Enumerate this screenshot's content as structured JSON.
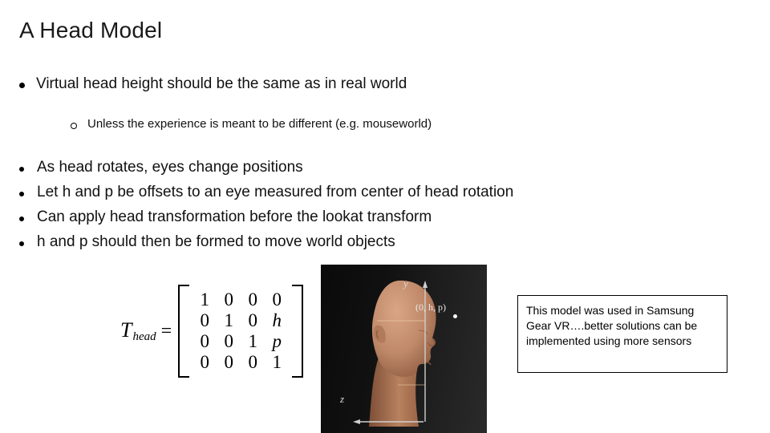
{
  "slide": {
    "title": "A Head Model"
  },
  "bullets": [
    {
      "level": 1,
      "text": "Virtual head height should be the same as in real world"
    },
    {
      "level": 2,
      "text": "Unless the experience is meant to be different (e.g. mouseworld)"
    },
    {
      "level": 1,
      "text": "As head rotates, eyes change positions"
    },
    {
      "level": 1,
      "text": "Let h and p be offsets to an eye measured from center  of head rotation"
    },
    {
      "level": 1,
      "text": "Can apply head transformation before the lookat transform"
    },
    {
      "level": 1,
      "text": "h and p should then be formed to move world objects"
    }
  ],
  "equation": {
    "label": "T",
    "label_subscript": "head",
    "equals": "=",
    "matrix_rows": [
      [
        "1",
        "0",
        "0",
        "0"
      ],
      [
        "0",
        "1",
        "0",
        "h"
      ],
      [
        "0",
        "0",
        "1",
        "p"
      ],
      [
        "0",
        "0",
        "0",
        "1"
      ]
    ],
    "italic_cells": [
      "h",
      "p"
    ]
  },
  "figure": {
    "axis_y_label": "y",
    "axis_z_label": "z",
    "point_label": "(0, h, p)"
  },
  "callout": {
    "text": "This model was used in Samsung Gear VR….better solutions can be implemented using more sensors"
  }
}
